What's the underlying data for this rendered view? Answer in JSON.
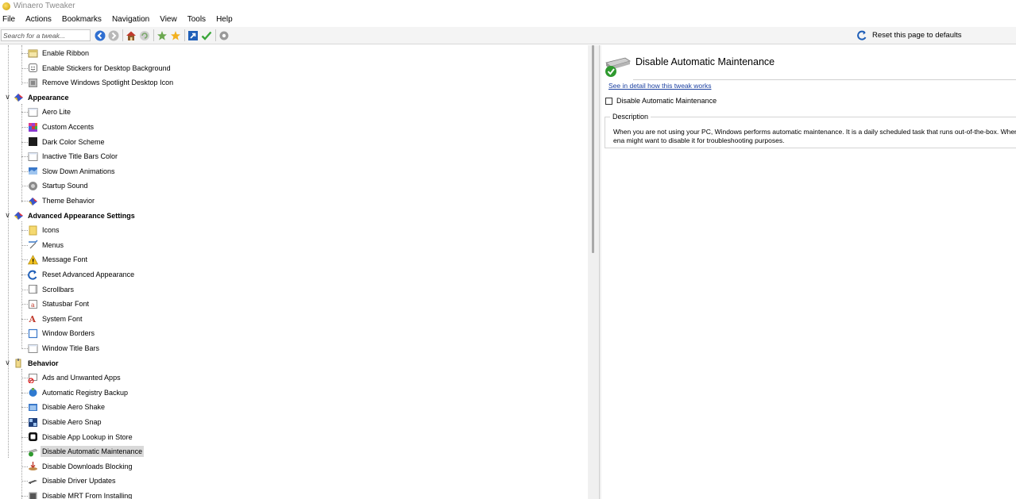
{
  "window": {
    "title": "Winaero Tweaker"
  },
  "menu": [
    "File",
    "Actions",
    "Bookmarks",
    "Navigation",
    "View",
    "Tools",
    "Help"
  ],
  "toolbar": {
    "search_placeholder": "Search for a tweak...",
    "reset_label": "Reset this page to defaults"
  },
  "tree": [
    {
      "label": "Enable Ribbon",
      "level": 1,
      "icon": "ribbon-icon"
    },
    {
      "label": "Enable Stickers for Desktop Background",
      "level": 1,
      "icon": "sticker-icon"
    },
    {
      "label": "Remove Windows Spotlight Desktop Icon",
      "level": 1,
      "icon": "spotlight-icon"
    },
    {
      "label": "Appearance",
      "level": 0,
      "icon": "appearance-icon",
      "expanded": true
    },
    {
      "label": "Aero Lite",
      "level": 1,
      "icon": "window-icon"
    },
    {
      "label": "Custom Accents",
      "level": 1,
      "icon": "palette-icon"
    },
    {
      "label": "Dark Color Scheme",
      "level": 1,
      "icon": "dark-scheme-icon"
    },
    {
      "label": "Inactive Title Bars Color",
      "level": 1,
      "icon": "window-icon"
    },
    {
      "label": "Slow Down Animations",
      "level": 1,
      "icon": "animation-icon"
    },
    {
      "label": "Startup Sound",
      "level": 1,
      "icon": "speaker-icon"
    },
    {
      "label": "Theme Behavior",
      "level": 1,
      "icon": "theme-icon"
    },
    {
      "label": "Advanced Appearance Settings",
      "level": 0,
      "icon": "appearance-icon",
      "expanded": true
    },
    {
      "label": "Icons",
      "level": 1,
      "icon": "folder-icon"
    },
    {
      "label": "Menus",
      "level": 1,
      "icon": "menu-icon"
    },
    {
      "label": "Message Font",
      "level": 1,
      "icon": "warning-icon"
    },
    {
      "label": "Reset Advanced Appearance",
      "level": 1,
      "icon": "reset-icon"
    },
    {
      "label": "Scrollbars",
      "level": 1,
      "icon": "scrollbar-icon"
    },
    {
      "label": "Statusbar Font",
      "level": 1,
      "icon": "font-icon"
    },
    {
      "label": "System Font",
      "level": 1,
      "icon": "font-a-icon"
    },
    {
      "label": "Window Borders",
      "level": 1,
      "icon": "window-border-icon"
    },
    {
      "label": "Window Title Bars",
      "level": 1,
      "icon": "window-icon"
    },
    {
      "label": "Behavior",
      "level": 0,
      "icon": "behavior-icon",
      "expanded": true
    },
    {
      "label": "Ads and Unwanted Apps",
      "level": 1,
      "icon": "no-ads-icon"
    },
    {
      "label": "Automatic Registry Backup",
      "level": 1,
      "icon": "registry-icon"
    },
    {
      "label": "Disable Aero Shake",
      "level": 1,
      "icon": "aero-shake-icon"
    },
    {
      "label": "Disable Aero Snap",
      "level": 1,
      "icon": "aero-snap-icon"
    },
    {
      "label": "Disable App Lookup in Store",
      "level": 1,
      "icon": "store-icon"
    },
    {
      "label": "Disable Automatic Maintenance",
      "level": 1,
      "icon": "maintenance-icon",
      "selected": true
    },
    {
      "label": "Disable Downloads Blocking",
      "level": 1,
      "icon": "download-icon"
    },
    {
      "label": "Disable Driver Updates",
      "level": 1,
      "icon": "driver-icon"
    },
    {
      "label": "Disable MRT From Installing",
      "level": 1,
      "icon": "mrt-icon"
    }
  ],
  "details": {
    "title": "Disable Automatic Maintenance",
    "link": "See in detail how this tweak works",
    "checkbox_label": "Disable Automatic Maintenance",
    "description_label": "Description",
    "description": "When you are not using your PC, Windows performs automatic maintenance. It is a daily scheduled task that runs out-of-the-box. When ena might want to disable it for troubleshooting purposes."
  }
}
